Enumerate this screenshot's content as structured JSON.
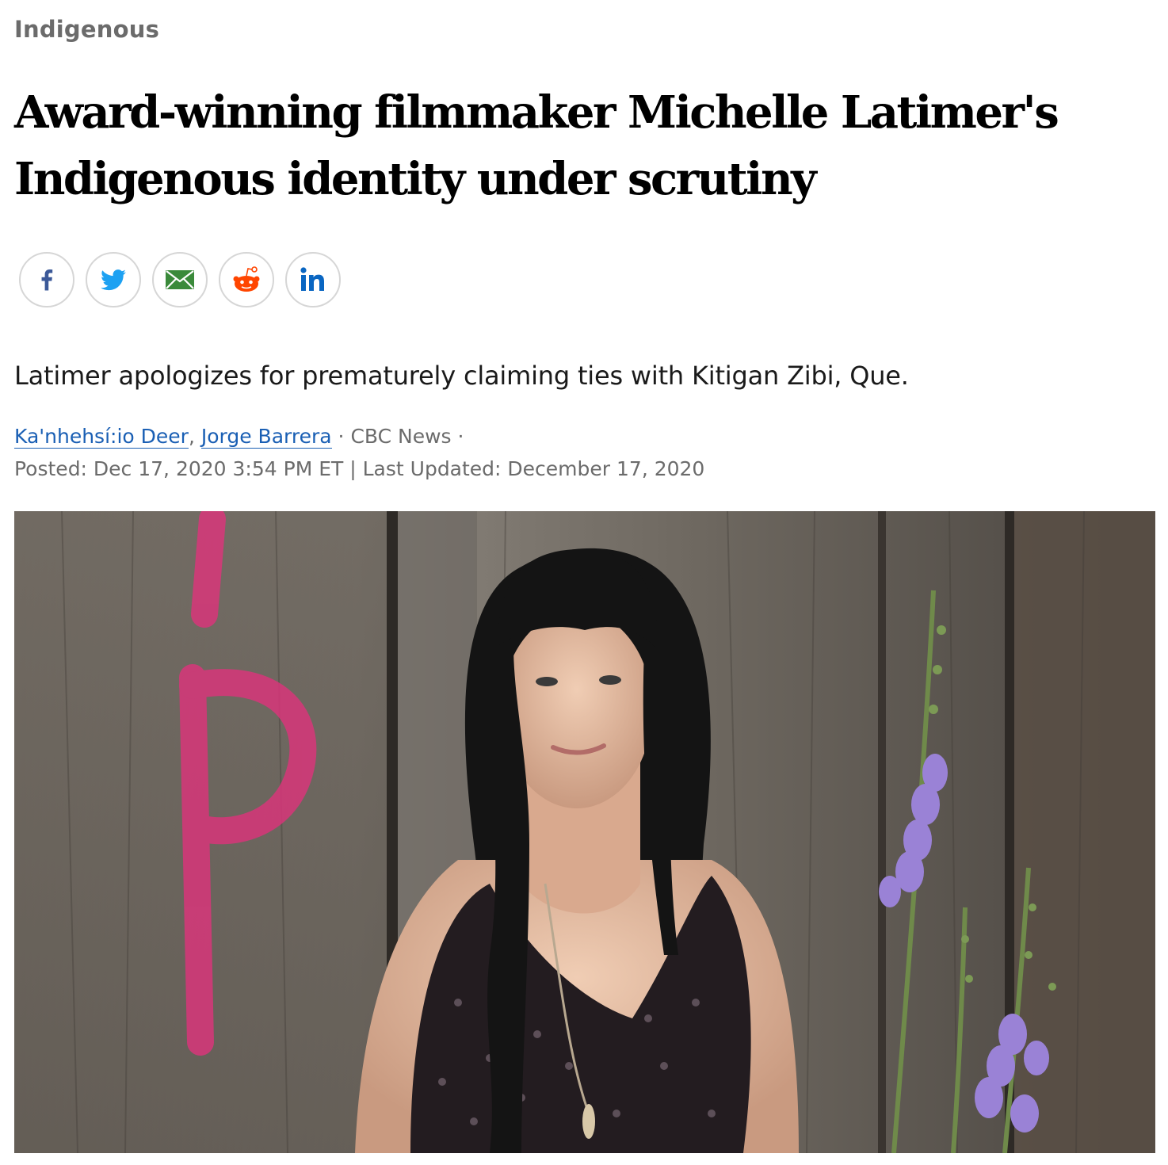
{
  "section": {
    "label": "Indigenous"
  },
  "headline": {
    "line1": "Award-winning filmmaker Michelle Latimer's",
    "line2": "Indigenous identity under scrutiny"
  },
  "share": {
    "buttons": [
      {
        "icon": "facebook-icon"
      },
      {
        "icon": "twitter-icon"
      },
      {
        "icon": "email-icon"
      },
      {
        "icon": "reddit-icon"
      },
      {
        "icon": "linkedin-icon"
      }
    ],
    "colors": {
      "facebook": "#3b5998",
      "twitter": "#1da1f2",
      "email": "#3a8a3a",
      "reddit": "#ff4500",
      "linkedin": "#0a66c2"
    }
  },
  "deck": "Latimer apologizes for prematurely claiming ties with Kitigan Zibi, Que.",
  "byline": {
    "authors": [
      "Ka'nhehsí:io Deer",
      "Jorge Barrera"
    ],
    "comma": ",",
    "dot": "·",
    "outlet": "CBC News",
    "trailing_dot": "·"
  },
  "timestamps": {
    "posted": "Posted: Dec 17, 2020 3:54 PM ET",
    "divider": "|",
    "updated": "Last Updated: December 17, 2020"
  },
  "photo": {
    "graffiti_letter": "P"
  }
}
